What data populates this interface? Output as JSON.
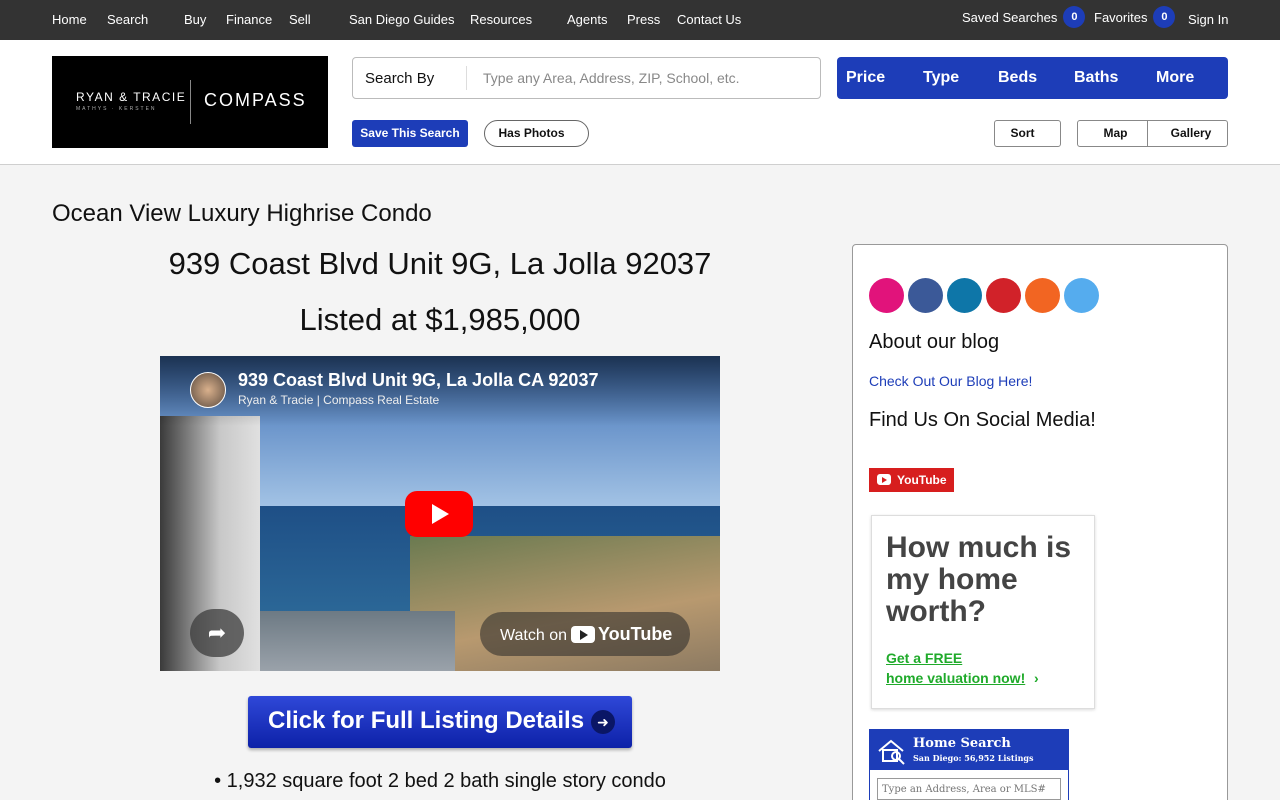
{
  "topnav": {
    "items": [
      {
        "label": "Home"
      },
      {
        "label": "Search",
        "dropdown": true
      },
      {
        "label": "Buy"
      },
      {
        "label": "Finance"
      },
      {
        "label": "Sell",
        "dropdown": true
      },
      {
        "label": "San Diego Guides"
      },
      {
        "label": "Resources",
        "dropdown": true
      },
      {
        "label": "Agents"
      },
      {
        "label": "Press"
      },
      {
        "label": "Contact Us"
      }
    ],
    "saved_searches_label": "Saved Searches",
    "saved_searches_count": "0",
    "favorites_label": "Favorites",
    "favorites_count": "0",
    "sign_in": "Sign In",
    "caret_glyph": "",
    "colors": {
      "bar": "#333333",
      "badge": "#1d3db8"
    }
  },
  "logo": {
    "name_line": "RYAN & TRACIE",
    "sub_line": "MATHYS · KERSTEN",
    "brand": "COMPASS"
  },
  "search": {
    "search_by_label": "Search By",
    "placeholder": "Type any Area, Address, ZIP, School, etc.",
    "value": ""
  },
  "filters": {
    "items": [
      {
        "label": "Price"
      },
      {
        "label": "Type"
      },
      {
        "label": "Beds"
      },
      {
        "label": "Baths"
      },
      {
        "label": "More"
      }
    ],
    "accent": "#1d3db8"
  },
  "toolbar": {
    "save_search": "Save This Search",
    "has_photos": "Has Photos",
    "sort": "Sort",
    "map": "Map",
    "gallery": "Gallery",
    "icon_glyph": ""
  },
  "listing": {
    "subtitle": "Ocean View Luxury Highrise Condo",
    "address": "939 Coast Blvd Unit 9G, La Jolla 92037",
    "price": "Listed at $1,985,000",
    "cta": "Click for Full Listing Details",
    "bullet": "• 1,932 square foot 2 bed 2 bath single story condo"
  },
  "video": {
    "title": "939 Coast Blvd Unit 9G, La Jolla CA 92037",
    "channel": "Ryan & Tracie | Compass Real Estate",
    "watch_on": "Watch on",
    "platform": "YouTube",
    "play_color": "#ff0000"
  },
  "sidebar": {
    "social_icons": [
      {
        "name": "instagram-icon",
        "color": "#e1137b"
      },
      {
        "name": "facebook-icon",
        "color": "#3b5998"
      },
      {
        "name": "linkedin-icon",
        "color": "#0e76a8"
      },
      {
        "name": "pinterest-icon",
        "color": "#d12229"
      },
      {
        "name": "rss-icon",
        "color": "#f26522"
      },
      {
        "name": "twitter-icon",
        "color": "#55acee"
      }
    ],
    "about_heading": "About our blog",
    "blog_link": "Check Out Our Blog Here!",
    "social_heading": "Find Us On Social Media!",
    "youtube_button": "YouTube",
    "valuation": {
      "heading": "How much is my home worth?",
      "link_line1": "Get a FREE",
      "link_line2": "home valuation now!",
      "chevron": "›",
      "accent": "#1faa2a"
    },
    "home_search": {
      "title": "Home Search",
      "subtitle": "San Diego: 56,952 Listings",
      "placeholder": "Type an Address, Area or MLS#"
    }
  }
}
